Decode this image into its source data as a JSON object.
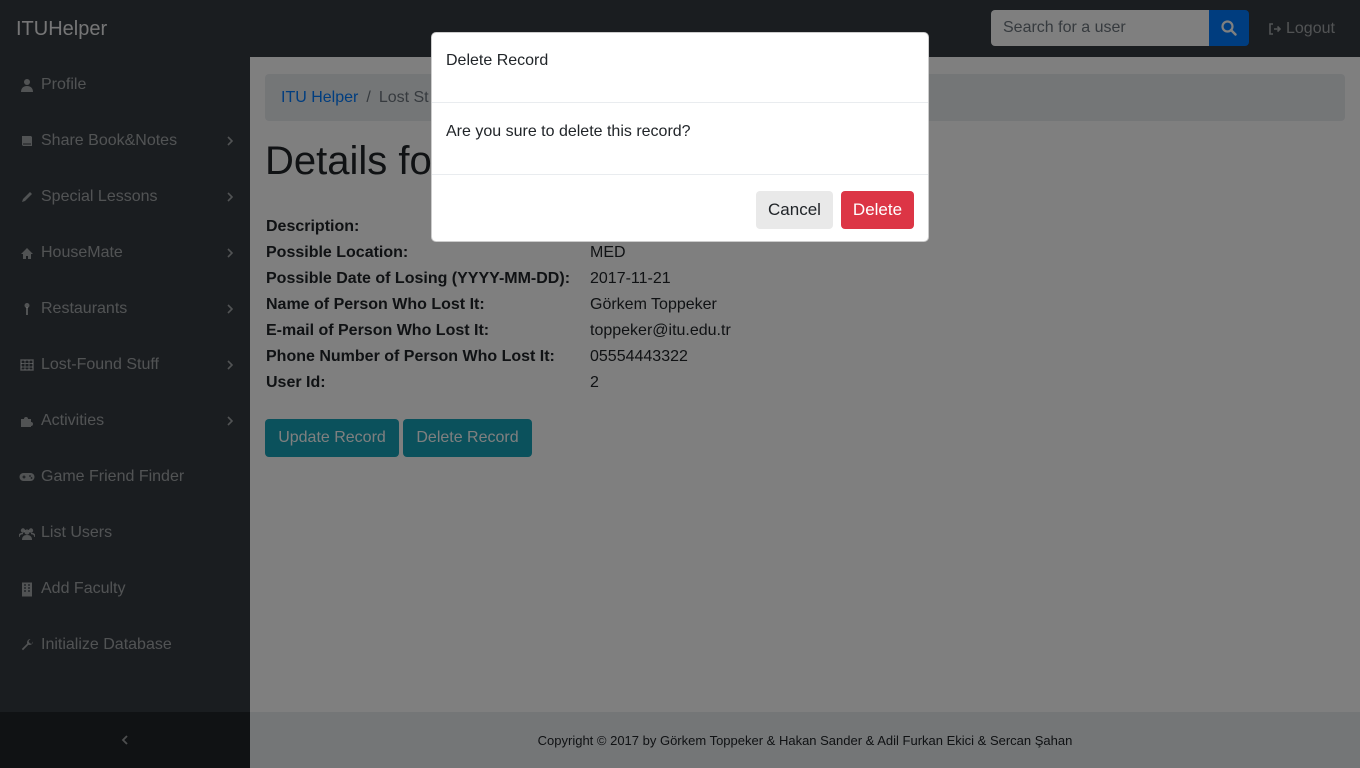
{
  "navbar": {
    "brand": "ITUHelper",
    "search_placeholder": "Search for a user",
    "logout_label": "Logout"
  },
  "sidebar": {
    "items": [
      {
        "label": "Profile",
        "icon": "user-icon",
        "has_submenu": false
      },
      {
        "label": "Share Book&Notes",
        "icon": "book-icon",
        "has_submenu": true
      },
      {
        "label": "Special Lessons",
        "icon": "pencil-icon",
        "has_submenu": true
      },
      {
        "label": "HouseMate",
        "icon": "home-icon",
        "has_submenu": true
      },
      {
        "label": "Restaurants",
        "icon": "thermometer-icon",
        "has_submenu": true
      },
      {
        "label": "Lost-Found Stuff",
        "icon": "table-icon",
        "has_submenu": true
      },
      {
        "label": "Activities",
        "icon": "puzzle-icon",
        "has_submenu": true
      },
      {
        "label": "Game Friend Finder",
        "icon": "gamepad-icon",
        "has_submenu": false
      },
      {
        "label": "List Users",
        "icon": "users-icon",
        "has_submenu": false
      },
      {
        "label": "Add Faculty",
        "icon": "building-icon",
        "has_submenu": false
      },
      {
        "label": "Initialize Database",
        "icon": "wrench-icon",
        "has_submenu": false
      }
    ]
  },
  "breadcrumb": {
    "home": "ITU Helper",
    "current": "Lost St"
  },
  "main": {
    "title": "Details fo",
    "details": [
      {
        "label": "Description:",
        "value": ""
      },
      {
        "label": "Possible Location:",
        "value": "MED"
      },
      {
        "label": "Possible Date of Losing (YYYY-MM-DD):",
        "value": "2017-11-21"
      },
      {
        "label": "Name of Person Who Lost It:",
        "value": "Görkem Toppeker"
      },
      {
        "label": "E-mail of Person Who Lost It:",
        "value": "toppeker@itu.edu.tr"
      },
      {
        "label": "Phone Number of Person Who Lost It:",
        "value": "05554443322"
      },
      {
        "label": "User Id:",
        "value": "2"
      }
    ],
    "update_label": "Update Record",
    "delete_label": "Delete Record"
  },
  "footer": {
    "text": "Copyright © 2017 by Görkem Toppeker & Hakan Sander & Adil Furkan Ekici & Sercan Şahan"
  },
  "modal": {
    "title": "Delete Record",
    "body": "Are you sure to delete this record?",
    "cancel_label": "Cancel",
    "delete_label": "Delete"
  },
  "colors": {
    "navbar": "#343a40",
    "primary": "#007bff",
    "info": "#17a2b8",
    "danger": "#dc3545"
  }
}
